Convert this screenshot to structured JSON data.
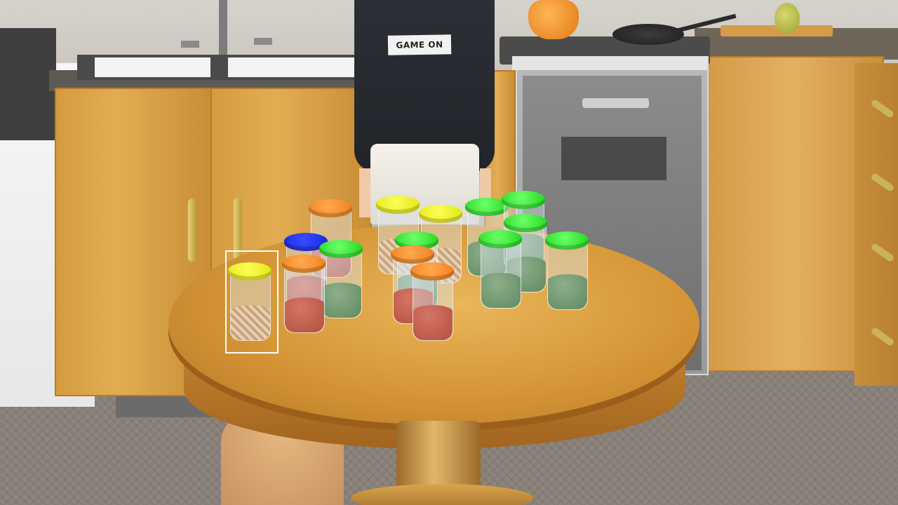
{
  "scene": {
    "character_shirt_text": "GAME ON",
    "selected_jar_id": "jar-yellow-front-left"
  },
  "colors": {
    "lid_orange": "#f58a28",
    "lid_yellow": "#eef31e",
    "lid_green": "#2ee92a",
    "lid_blue": "#1f34ef",
    "selection_outline": "#ffffff",
    "table_wood": "#d89a3a"
  },
  "jars": [
    {
      "id": "jar-orange-back-1",
      "lid": "orange",
      "fill": "red"
    },
    {
      "id": "jar-yellow-back-1",
      "lid": "yellow",
      "fill": "tan"
    },
    {
      "id": "jar-yellow-back-2",
      "lid": "yellow",
      "fill": "tan"
    },
    {
      "id": "jar-green-back-1",
      "lid": "green",
      "fill": "green"
    },
    {
      "id": "jar-green-back-2",
      "lid": "green",
      "fill": "green"
    },
    {
      "id": "jar-blue-1",
      "lid": "blue",
      "fill": "red"
    },
    {
      "id": "jar-green-mid-1",
      "lid": "green",
      "fill": "green"
    },
    {
      "id": "jar-green-mid-2",
      "lid": "green",
      "fill": "green"
    },
    {
      "id": "jar-green-mid-3",
      "lid": "green",
      "fill": "green"
    },
    {
      "id": "jar-orange-mid-1",
      "lid": "orange",
      "fill": "red"
    },
    {
      "id": "jar-orange-mid-2",
      "lid": "orange",
      "fill": "red"
    },
    {
      "id": "jar-green-front-1",
      "lid": "green",
      "fill": "green"
    },
    {
      "id": "jar-green-front-2",
      "lid": "green",
      "fill": "green"
    },
    {
      "id": "jar-yellow-front-left",
      "lid": "yellow",
      "fill": "tan"
    },
    {
      "id": "jar-orange-front-1",
      "lid": "orange",
      "fill": "red"
    },
    {
      "id": "jar-orange-front-2",
      "lid": "orange",
      "fill": "red"
    }
  ]
}
